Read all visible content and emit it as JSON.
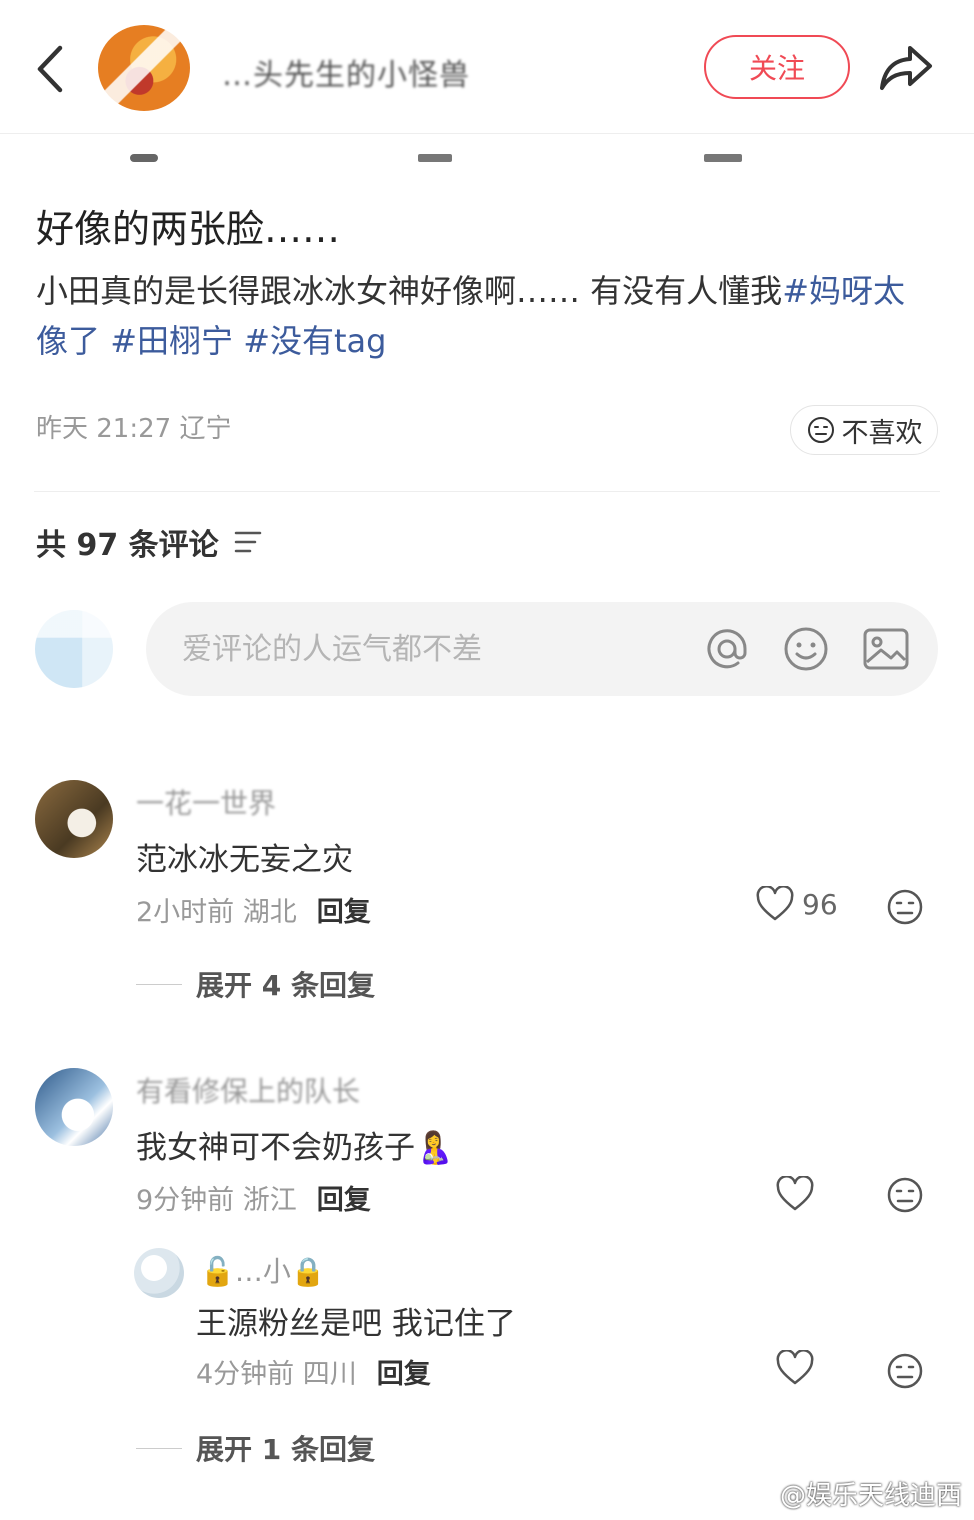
{
  "header": {
    "author_name": "…头先生的小怪兽",
    "follow_label": "关注"
  },
  "post": {
    "title": "好像的两张脸……",
    "body_text": "小田真的是长得跟冰冰女神好像啊…… 有没有人懂我",
    "tags": [
      "#妈呀太像了",
      "#田栩宁",
      "#没有tag"
    ],
    "meta": "昨天 21:27 辽宁",
    "dislike_label": "不喜欢"
  },
  "comments_header": {
    "count_label": "共 97 条评论"
  },
  "comment_input": {
    "placeholder": "爱评论的人运气都不差"
  },
  "comments": [
    {
      "name": "一花一世界",
      "text": "范冰冰无妄之灾",
      "time_location": "2小时前 湖北",
      "reply_label": "回复",
      "likes": "96",
      "expand_label": "展开 4 条回复"
    },
    {
      "name": "有看修保上的队长",
      "text": "我女神可不会奶孩子🤱",
      "time_location": "9分钟前 浙江",
      "reply_label": "回复",
      "likes": "",
      "replies": [
        {
          "name": "🔓…小🔒",
          "text": "王源粉丝是吧 我记住了",
          "time_location": "4分钟前 四川",
          "reply_label": "回复",
          "likes": ""
        }
      ],
      "expand_label": "展开 1 条回复"
    }
  ],
  "watermark": "@娱乐天线迪西"
}
